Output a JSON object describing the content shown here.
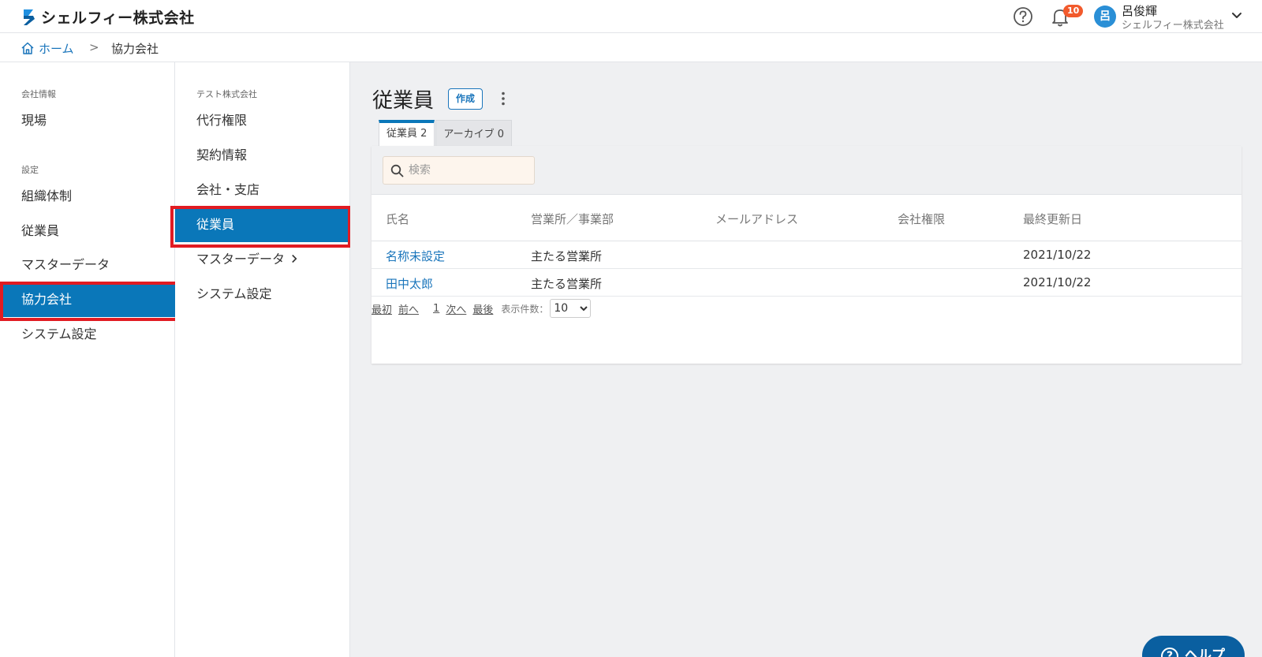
{
  "header": {
    "app_name": "シェルフィー株式会社",
    "notification_count": "10",
    "user_avatar_initial": "呂",
    "user_name": "呂俊輝",
    "user_company": "シェルフィー株式会社"
  },
  "breadcrumb": {
    "home": "ホーム",
    "separator": ">",
    "current": "協力会社"
  },
  "sidebar": {
    "section_company": "会社情報",
    "section_settings": "設定",
    "items": [
      {
        "label": "現場"
      },
      {
        "label": "組織体制"
      },
      {
        "label": "従業員"
      },
      {
        "label": "マスターデータ"
      },
      {
        "label": "協力会社",
        "active": true
      },
      {
        "label": "システム設定"
      }
    ]
  },
  "subnav": {
    "section": "テスト株式会社",
    "items": [
      {
        "label": "代行権限"
      },
      {
        "label": "契約情報"
      },
      {
        "label": "会社・支店"
      },
      {
        "label": "従業員",
        "active": true
      },
      {
        "label": "マスターデータ"
      },
      {
        "label": "システム設定"
      }
    ]
  },
  "main": {
    "title": "従業員",
    "create_label": "作成",
    "tabs": [
      {
        "label": "従業員 2",
        "active": true
      },
      {
        "label": "アーカイブ 0"
      }
    ],
    "search_placeholder": "検索",
    "columns": [
      "氏名",
      "営業所／事業部",
      "メールアドレス",
      "会社権限",
      "最終更新日"
    ],
    "rows": [
      {
        "name": "名称未設定",
        "office": "主たる営業所",
        "email": "",
        "role": "",
        "updated": "2021/10/22"
      },
      {
        "name": "田中太郎",
        "office": "主たる営業所",
        "email": "",
        "role": "",
        "updated": "2021/10/22"
      }
    ],
    "pager": {
      "first": "最初",
      "prev": "前へ",
      "page": "1",
      "next": "次へ",
      "last": "最後",
      "per_page_label": "表示件数：",
      "per_page_value": "10"
    }
  },
  "help_button": {
    "label": "ヘルプ"
  },
  "colors": {
    "primary": "#0a77b9",
    "link": "#1a75bb",
    "highlight": "#e11b22",
    "badge": "#f25a2c"
  }
}
